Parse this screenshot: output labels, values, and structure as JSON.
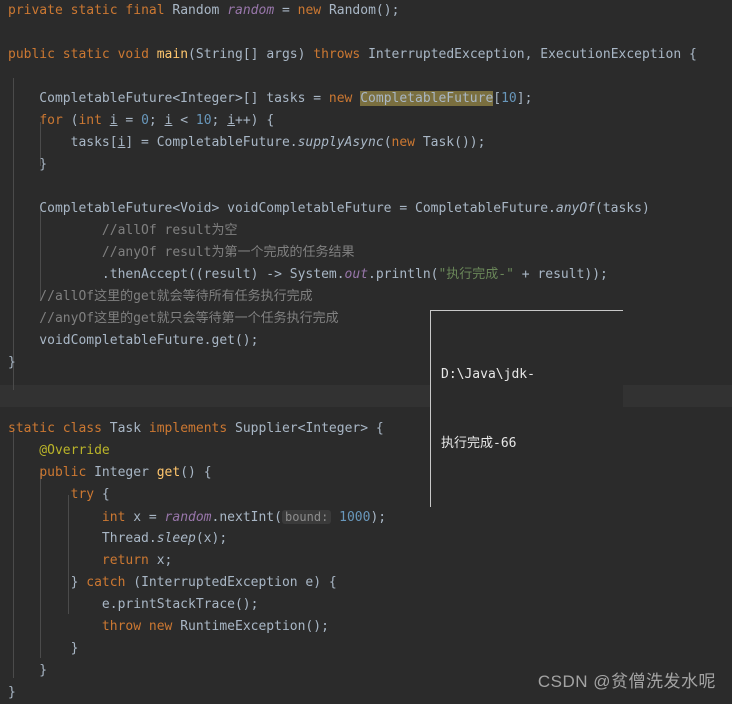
{
  "app": {
    "title": "Java source editor",
    "theme": "darcula",
    "background": "#2b2b2b",
    "foreground": "#a9b7c6"
  },
  "colors": {
    "keyword": "#cc7832",
    "number": "#6897bb",
    "string": "#6a8759",
    "comment": "#808080",
    "annotation": "#bbb529",
    "static_field": "#9876aa",
    "method_declaration": "#ffc66d",
    "search_highlight": "#7a6f3f",
    "inlay_hint_bg": "#3a3a3a",
    "band": "#323232"
  },
  "code": {
    "lines": [
      {
        "indent": 0,
        "tokens": [
          {
            "t": "private",
            "c": "kw"
          },
          {
            "t": " ",
            "c": "txt"
          },
          {
            "t": "static",
            "c": "kw"
          },
          {
            "t": " ",
            "c": "txt"
          },
          {
            "t": "final",
            "c": "kw"
          },
          {
            "t": " Random ",
            "c": "txt"
          },
          {
            "t": "random",
            "c": "fld"
          },
          {
            "t": " = ",
            "c": "txt"
          },
          {
            "t": "new",
            "c": "kw"
          },
          {
            "t": " Random();",
            "c": "txt"
          }
        ]
      },
      {
        "indent": 0,
        "tokens": []
      },
      {
        "indent": 0,
        "tokens": [
          {
            "t": "public",
            "c": "kw"
          },
          {
            "t": " ",
            "c": "txt"
          },
          {
            "t": "static",
            "c": "kw"
          },
          {
            "t": " ",
            "c": "txt"
          },
          {
            "t": "void",
            "c": "kw"
          },
          {
            "t": " ",
            "c": "txt"
          },
          {
            "t": "main",
            "c": "mtdb"
          },
          {
            "t": "(String[] args) ",
            "c": "txt"
          },
          {
            "t": "throws",
            "c": "kw"
          },
          {
            "t": " InterruptedException, ExecutionException {",
            "c": "txt"
          }
        ]
      },
      {
        "indent": 0,
        "tokens": []
      },
      {
        "indent": 0,
        "tokens": [
          {
            "t": "    CompletableFuture<Integer>[] tasks = ",
            "c": "txt"
          },
          {
            "t": "new",
            "c": "kw"
          },
          {
            "t": " ",
            "c": "txt"
          },
          {
            "t": "CompletableFuture",
            "c": "hl"
          },
          {
            "t": "[",
            "c": "txt"
          },
          {
            "t": "10",
            "c": "num"
          },
          {
            "t": "];",
            "c": "txt"
          }
        ]
      },
      {
        "indent": 0,
        "tokens": [
          {
            "t": "    ",
            "c": "txt"
          },
          {
            "t": "for",
            "c": "kw"
          },
          {
            "t": " (",
            "c": "txt"
          },
          {
            "t": "int",
            "c": "kw"
          },
          {
            "t": " ",
            "c": "txt"
          },
          {
            "t": "i",
            "c": "loc"
          },
          {
            "t": " = ",
            "c": "txt"
          },
          {
            "t": "0",
            "c": "num"
          },
          {
            "t": "; ",
            "c": "txt"
          },
          {
            "t": "i",
            "c": "loc"
          },
          {
            "t": " < ",
            "c": "txt"
          },
          {
            "t": "10",
            "c": "num"
          },
          {
            "t": "; ",
            "c": "txt"
          },
          {
            "t": "i",
            "c": "loc"
          },
          {
            "t": "++) {",
            "c": "txt"
          }
        ]
      },
      {
        "indent": 0,
        "tokens": [
          {
            "t": "        tasks[",
            "c": "txt"
          },
          {
            "t": "i",
            "c": "loc"
          },
          {
            "t": "] = CompletableFuture.",
            "c": "txt"
          },
          {
            "t": "supplyAsync",
            "c": "mtd"
          },
          {
            "t": "(",
            "c": "txt"
          },
          {
            "t": "new",
            "c": "kw"
          },
          {
            "t": " Task());",
            "c": "txt"
          }
        ]
      },
      {
        "indent": 0,
        "tokens": [
          {
            "t": "    }",
            "c": "txt"
          }
        ]
      },
      {
        "indent": 0,
        "tokens": []
      },
      {
        "indent": 0,
        "tokens": [
          {
            "t": "    CompletableFuture<Void> voidCompletableFuture = CompletableFuture.",
            "c": "txt"
          },
          {
            "t": "anyOf",
            "c": "mtd"
          },
          {
            "t": "(tasks)",
            "c": "txt"
          }
        ]
      },
      {
        "indent": 0,
        "tokens": [
          {
            "t": "            //allOf result为空",
            "c": "cmt"
          }
        ]
      },
      {
        "indent": 0,
        "tokens": [
          {
            "t": "            //anyOf result为第一个完成的任务结果",
            "c": "cmt"
          }
        ]
      },
      {
        "indent": 0,
        "tokens": [
          {
            "t": "            .thenAccept((result) -> System.",
            "c": "txt"
          },
          {
            "t": "out",
            "c": "fld"
          },
          {
            "t": ".println(",
            "c": "txt"
          },
          {
            "t": "\"执行完成-\"",
            "c": "str"
          },
          {
            "t": " + result));",
            "c": "txt"
          }
        ]
      },
      {
        "indent": 0,
        "tokens": [
          {
            "t": "    //allOf这里的get就会等待所有任务执行完成",
            "c": "cmt"
          }
        ]
      },
      {
        "indent": 0,
        "tokens": [
          {
            "t": "    //anyOf这里的get就只会等待第一个任务执行完成",
            "c": "cmt"
          }
        ]
      },
      {
        "indent": 0,
        "tokens": [
          {
            "t": "    voidCompletableFuture.get();",
            "c": "txt"
          }
        ]
      },
      {
        "indent": 0,
        "tokens": [
          {
            "t": "}",
            "c": "txt"
          }
        ]
      },
      {
        "indent": 0,
        "tokens": []
      },
      {
        "indent": 0,
        "tokens": []
      },
      {
        "indent": 0,
        "tokens": [
          {
            "t": "static",
            "c": "kw"
          },
          {
            "t": " ",
            "c": "txt"
          },
          {
            "t": "class",
            "c": "kw"
          },
          {
            "t": " Task ",
            "c": "txt"
          },
          {
            "t": "implements",
            "c": "kw"
          },
          {
            "t": " Supplier<Integer> {",
            "c": "txt"
          }
        ]
      },
      {
        "indent": 0,
        "tokens": [
          {
            "t": "    @Override",
            "c": "anno"
          }
        ]
      },
      {
        "indent": 0,
        "tokens": [
          {
            "t": "    ",
            "c": "txt"
          },
          {
            "t": "public",
            "c": "kw"
          },
          {
            "t": " Integer ",
            "c": "txt"
          },
          {
            "t": "get",
            "c": "mtdb"
          },
          {
            "t": "() {",
            "c": "txt"
          }
        ]
      },
      {
        "indent": 0,
        "tokens": [
          {
            "t": "        ",
            "c": "txt"
          },
          {
            "t": "try",
            "c": "kw"
          },
          {
            "t": " {",
            "c": "txt"
          }
        ]
      },
      {
        "indent": 0,
        "tokens": [
          {
            "t": "            ",
            "c": "txt"
          },
          {
            "t": "int",
            "c": "kw"
          },
          {
            "t": " x = ",
            "c": "txt"
          },
          {
            "t": "random",
            "c": "fld"
          },
          {
            "t": ".nextInt(",
            "c": "txt"
          },
          {
            "t": "bound:",
            "c": "inlay"
          },
          {
            "t": " ",
            "c": "txt"
          },
          {
            "t": "1000",
            "c": "num"
          },
          {
            "t": ");",
            "c": "txt"
          }
        ]
      },
      {
        "indent": 0,
        "tokens": [
          {
            "t": "            Thread.",
            "c": "txt"
          },
          {
            "t": "sleep",
            "c": "mtd"
          },
          {
            "t": "(x);",
            "c": "txt"
          }
        ]
      },
      {
        "indent": 0,
        "tokens": [
          {
            "t": "            ",
            "c": "txt"
          },
          {
            "t": "return",
            "c": "kw"
          },
          {
            "t": " x;",
            "c": "txt"
          }
        ]
      },
      {
        "indent": 0,
        "tokens": [
          {
            "t": "        } ",
            "c": "txt"
          },
          {
            "t": "catch",
            "c": "kw"
          },
          {
            "t": " (InterruptedException e) {",
            "c": "txt"
          }
        ]
      },
      {
        "indent": 0,
        "tokens": [
          {
            "t": "            e.printStackTrace();",
            "c": "txt"
          }
        ]
      },
      {
        "indent": 0,
        "tokens": [
          {
            "t": "            ",
            "c": "txt"
          },
          {
            "t": "throw",
            "c": "kw"
          },
          {
            "t": " ",
            "c": "txt"
          },
          {
            "t": "new",
            "c": "kw"
          },
          {
            "t": " RuntimeException();",
            "c": "txt"
          }
        ]
      },
      {
        "indent": 0,
        "tokens": [
          {
            "t": "        }",
            "c": "txt"
          }
        ]
      },
      {
        "indent": 0,
        "tokens": [
          {
            "t": "    }",
            "c": "txt"
          }
        ]
      },
      {
        "indent": 0,
        "tokens": [
          {
            "t": "}",
            "c": "txt"
          }
        ]
      }
    ]
  },
  "console_popup": {
    "lines": [
      "D:\\Java\\jdk-",
      "执行完成-66"
    ]
  },
  "watermark": {
    "text": "CSDN @贫僧洗发水呢"
  }
}
